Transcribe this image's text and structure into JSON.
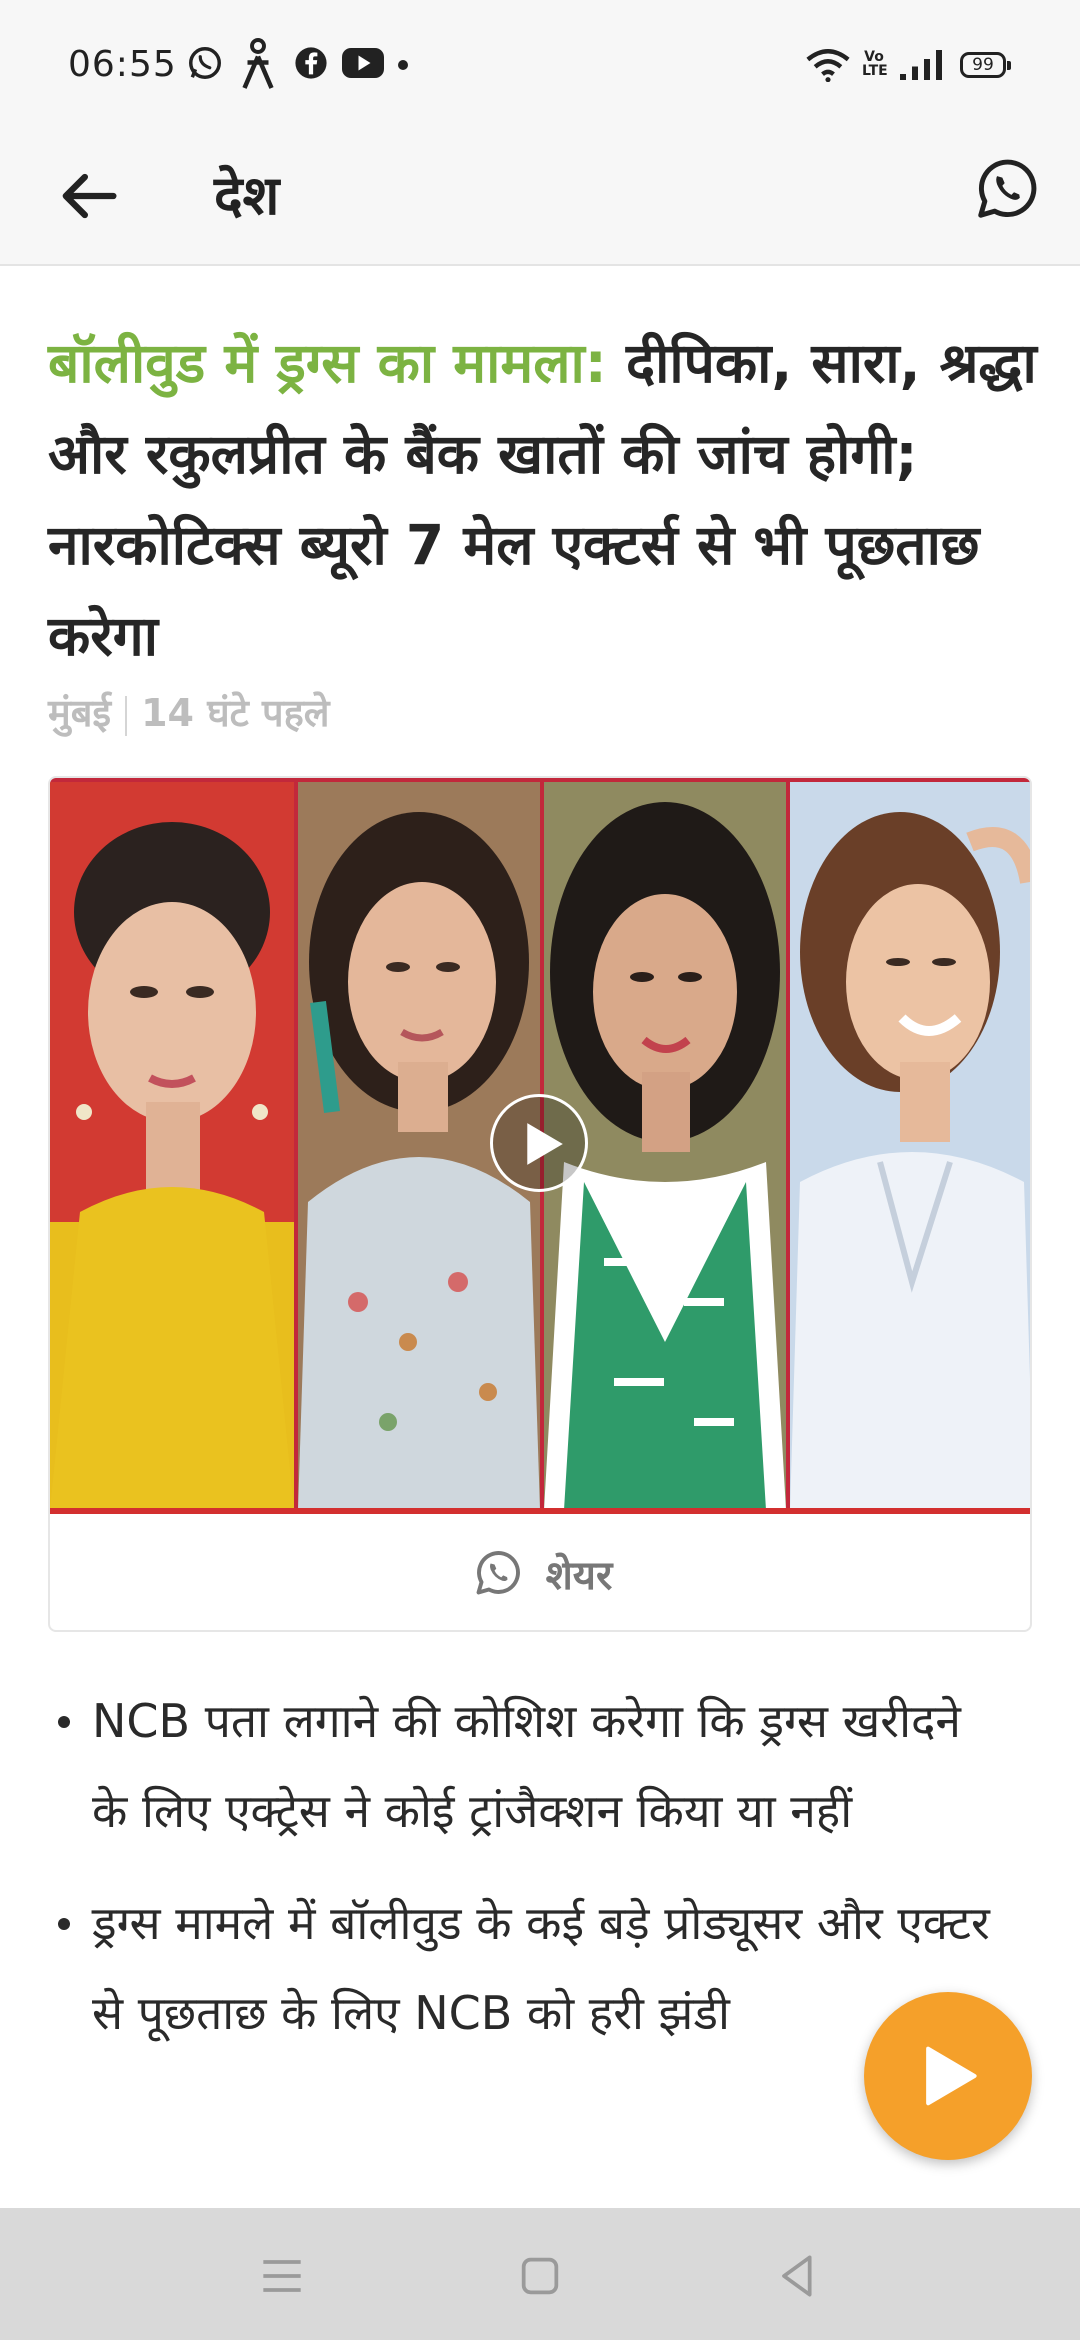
{
  "status_bar": {
    "time": "06:55",
    "battery": "99",
    "network_label": "Vo LTE",
    "icons": [
      "whatsapp-icon",
      "accessibility-icon",
      "facebook-icon",
      "youtube-icon",
      "wifi-icon",
      "signal-icon",
      "battery-icon"
    ]
  },
  "app_bar": {
    "title": "देश",
    "back_icon": "arrow-left-icon",
    "share_icon": "whatsapp-icon"
  },
  "article": {
    "kicker": "बॉलीवुड में ड्रग्स का मामला:",
    "title": "दीपिका, सारा, श्रद्धा और रकुलप्रीत के बैंक खातों की जांच होगी; नारकोटिक्स ब्यूरो 7 मेल एक्टर्स से भी पूछताछ करेगा",
    "location": "मुंबई",
    "time_ago": "14 घंटे पहले",
    "share_label": "शेयर",
    "bullets": [
      "NCB पता लगाने की कोशिश करेगा कि ड्रग्स खरीदने के लिए एक्ट्रेस ने कोई ट्रांजैक्शन किया या नहीं",
      "ड्रग्स मामले में बॉलीवुड के कई बड़े प्रोड्यूसर और एक्टर से पूछताछ के लिए NCB को हरी झंडी"
    ]
  },
  "colors": {
    "kicker": "#7cb342",
    "fab": "#f5a02a",
    "accent_red": "#d32f2f"
  }
}
